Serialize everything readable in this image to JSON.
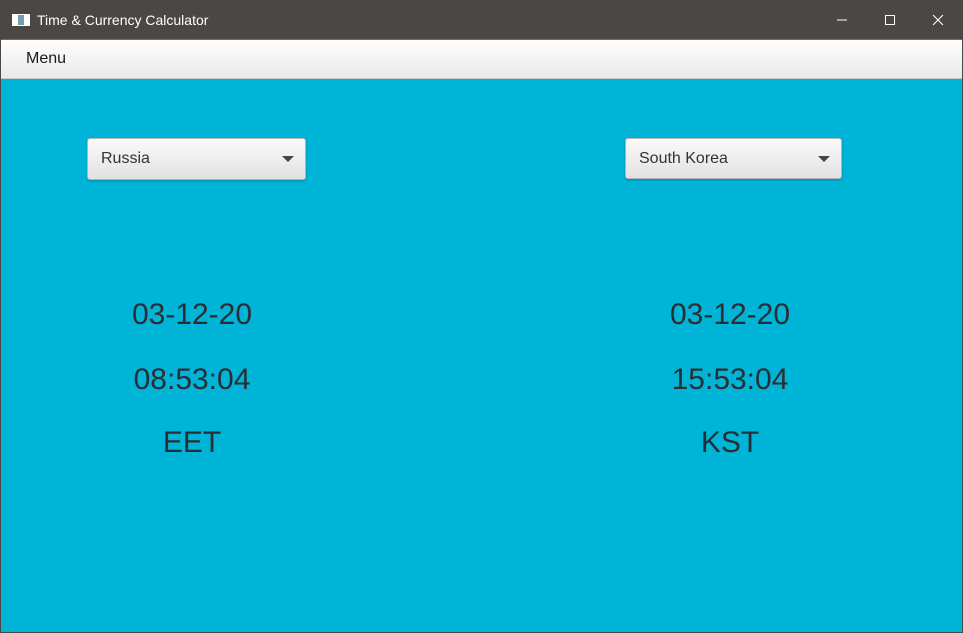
{
  "window": {
    "title": "Time & Currency Calculator",
    "controls": {
      "minimize": "—",
      "maximize": "☐",
      "close": "✕"
    }
  },
  "menubar": {
    "menu_label": "Menu"
  },
  "left": {
    "country": "Russia",
    "date": "03-12-20",
    "time": "08:53:04",
    "timezone": "EET"
  },
  "right": {
    "country": "South Korea",
    "date": "03-12-20",
    "time": "15:53:04",
    "timezone": "KST"
  },
  "colors": {
    "background": "#00b4d8",
    "titlebar": "#4a4744",
    "text": "#2a2e33"
  },
  "icons": {
    "app": "app-window-icon",
    "minimize": "minimize-icon",
    "maximize": "maximize-icon",
    "close": "close-icon",
    "dropdown": "chevron-down-icon"
  }
}
